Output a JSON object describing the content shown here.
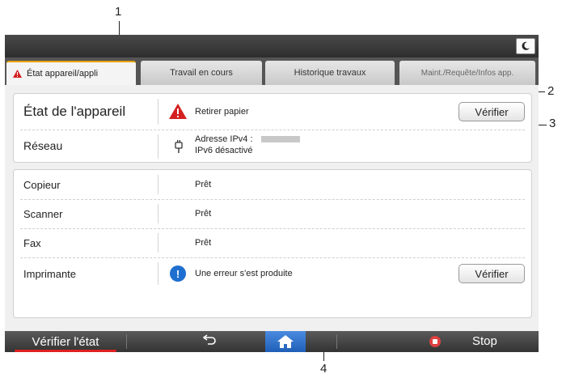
{
  "callouts": {
    "c1": "1",
    "c2": "2",
    "c3": "3",
    "c4": "4"
  },
  "tabs": [
    {
      "label": "État appareil/appli",
      "active": true
    },
    {
      "label": "Travail en cours"
    },
    {
      "label": "Historique travaux"
    },
    {
      "label": "Maint./Requête/Infos app."
    }
  ],
  "device_status": {
    "label": "État de l'appareil",
    "value": "Retirer papier",
    "check_label": "Vérifier"
  },
  "network": {
    "label": "Réseau",
    "ipv4": "Adresse IPv4 :",
    "ipv6": "IPv6 désactivé"
  },
  "functions": [
    {
      "label": "Copieur",
      "value": "Prêt"
    },
    {
      "label": "Scanner",
      "value": "Prêt"
    },
    {
      "label": "Fax",
      "value": "Prêt"
    },
    {
      "label": "Imprimante",
      "value": "Une erreur s'est produite",
      "check_label": "Vérifier"
    }
  ],
  "bottom_bar": {
    "check_status": "Vérifier l'état",
    "back_icon": "back-arrow-icon",
    "home_icon": "home-icon",
    "stop": "Stop"
  },
  "colors": {
    "warning": "#d42020",
    "info": "#1f6fd0",
    "accent_orange": "#e8a000",
    "home_blue": "#2d6fcc"
  }
}
